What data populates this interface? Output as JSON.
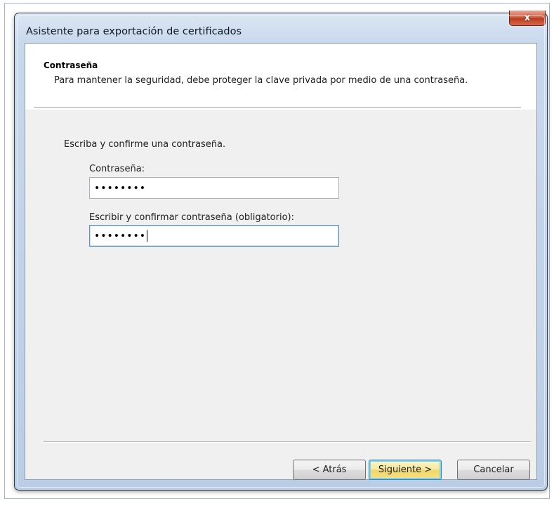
{
  "window": {
    "title": "Asistente para exportación de certificados",
    "close_glyph": "x"
  },
  "header": {
    "section_title": "Contraseña",
    "description": "Para mantener la seguridad, debe proteger la clave privada por medio de una contraseña."
  },
  "form": {
    "instruction": "Escriba y confirme una contraseña.",
    "password_label": "Contraseña:",
    "password_value": "••••••••",
    "confirm_label": "Escribir y confirmar contraseña (obligatorio):",
    "confirm_value": "••••••••"
  },
  "buttons": {
    "back": "< Atrás",
    "next": "Siguiente >",
    "cancel": "Cancelar"
  },
  "colors": {
    "close_button": "#c9432a",
    "default_button": "#f6e08a",
    "focus_border": "#5c90c8"
  }
}
